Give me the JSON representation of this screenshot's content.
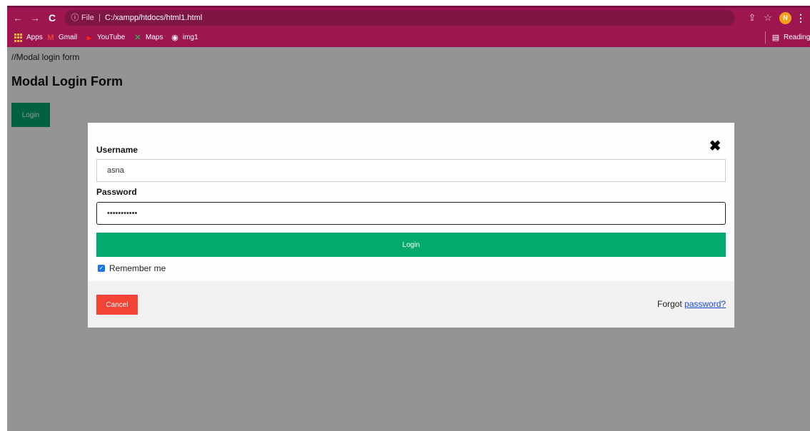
{
  "browser": {
    "nav": {
      "back_icon": "←",
      "forward_icon": "→",
      "reload_icon": "C"
    },
    "address": {
      "info_icon": "ⓘ",
      "scheme_label": "File",
      "separator": "|",
      "url": "C:/xampp/htdocs/html1.html"
    },
    "toolbar": {
      "share_icon": "⇪",
      "star_icon": "☆",
      "profile_initial": "N",
      "menu_icon": "⋮"
    },
    "bookmarks": [
      {
        "label": "Apps"
      },
      {
        "label": "Gmail",
        "icon": "M"
      },
      {
        "label": "YouTube",
        "icon": "▶"
      },
      {
        "label": "Maps",
        "icon": "✕"
      },
      {
        "label": "img1",
        "icon": "◉"
      }
    ],
    "reading_list": {
      "label": "Reading list",
      "icon": "▤"
    }
  },
  "page": {
    "comment": "//Modal login form",
    "title": "Modal Login Form",
    "open_button": "Login"
  },
  "modal": {
    "close_icon": "✖",
    "username_label": "Username",
    "username_value": "asna",
    "password_label": "Password",
    "password_value": "•••••••••••",
    "submit_label": "Login",
    "remember_checked": true,
    "remember_check_icon": "✓",
    "remember_label": "Remember me",
    "cancel_label": "Cancel",
    "forgot_text": "Forgot",
    "forgot_link": "password?"
  },
  "colors": {
    "browser_chrome": "#9d164f",
    "primary_green": "#04aa6d",
    "cancel_red": "#f44336",
    "link_blue": "#1a4cd0"
  }
}
